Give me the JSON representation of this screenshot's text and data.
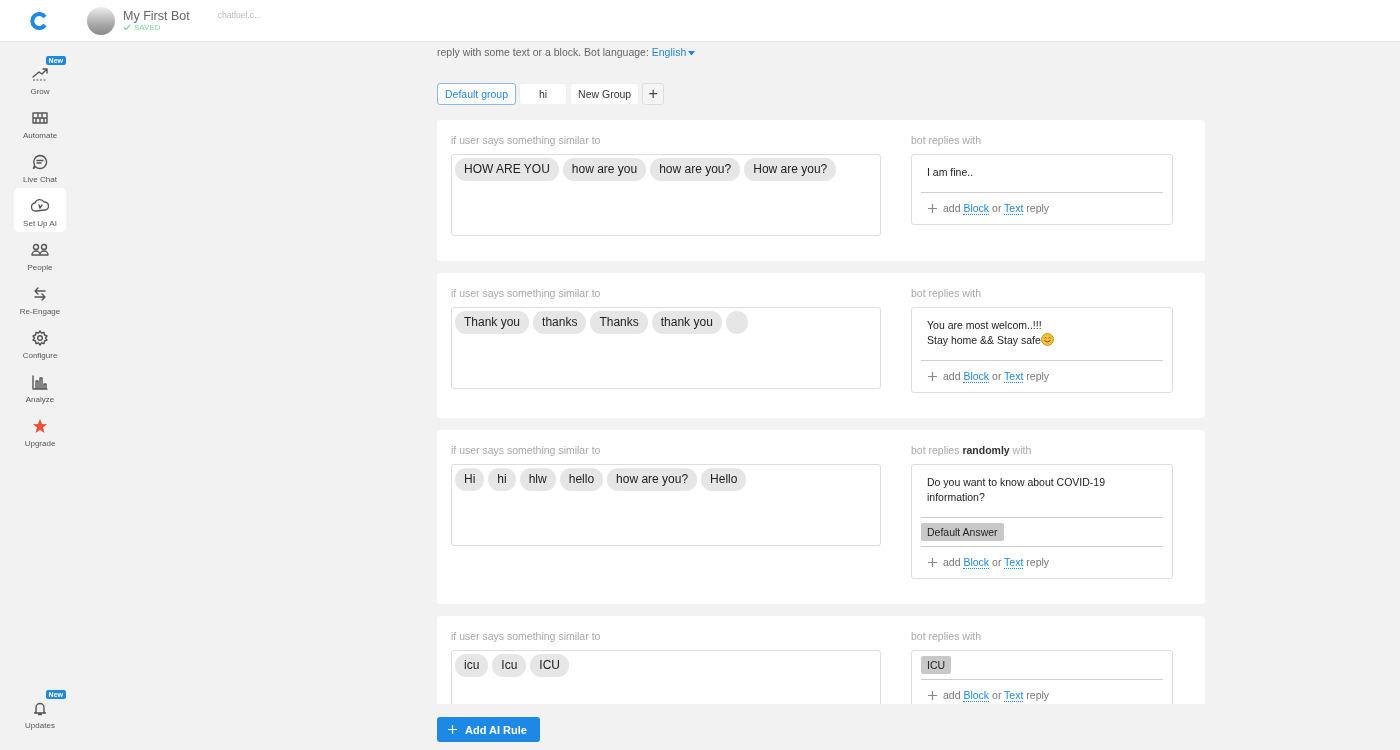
{
  "header": {
    "bot_name": "My First Bot",
    "status": "SAVED",
    "url": "chatfuel.c..."
  },
  "sidebar": {
    "items": [
      {
        "label": "Grow",
        "badge": "New",
        "selected": false
      },
      {
        "label": "Automate",
        "selected": false
      },
      {
        "label": "Live Chat",
        "selected": false
      },
      {
        "label": "Set Up AI",
        "selected": true
      },
      {
        "label": "People",
        "selected": false
      },
      {
        "label": "Re-Engage",
        "selected": false
      },
      {
        "label": "Configure",
        "selected": false
      },
      {
        "label": "Analyze",
        "selected": false
      },
      {
        "label": "Upgrade",
        "selected": false
      }
    ],
    "bottom_item": {
      "label": "Updates",
      "badge": "New"
    }
  },
  "intro": {
    "text": "reply with some text or a block. Bot language:",
    "language": "English"
  },
  "groups": [
    {
      "label": "Default group",
      "selected": true
    },
    {
      "label": "hi",
      "selected": false
    },
    {
      "label": "New Group",
      "selected": false
    }
  ],
  "add_group": "+",
  "rules": [
    {
      "user_label": "if user says something similar to",
      "phrases": [
        "HOW ARE YOU",
        "how are you",
        "how are you?",
        "How are you?"
      ],
      "input_chip": false,
      "bot_label": "bot replies with",
      "replies": [
        {
          "kind": "text",
          "text": "I am fine.."
        }
      ],
      "footer": {
        "add": "add",
        "block": "Block",
        "or": "or",
        "text": "Text",
        "reply": "reply"
      }
    },
    {
      "user_label": "if user says something similar to",
      "phrases": [
        "Thank you",
        "thanks",
        "Thanks",
        "thank you"
      ],
      "input_chip": true,
      "bot_label": "bot replies with",
      "replies": [
        {
          "kind": "emoji",
          "lines": [
            "You are most welcom..!!!",
            "Stay home && Stay safe"
          ]
        }
      ],
      "footer": {
        "add": "add",
        "block": "Block",
        "or": "or",
        "text": "Text",
        "reply": "reply"
      }
    },
    {
      "user_label": "if user says something similar to",
      "phrases": [
        "Hi",
        "hi",
        "hlw",
        "hello",
        "how are you?",
        "Hello"
      ],
      "input_chip": false,
      "bot_label": "bot replies **randomly** with",
      "replies": [
        {
          "kind": "text",
          "text": "Do you want to know about  COVID-19 information?"
        },
        {
          "kind": "block",
          "text": "Default Answer"
        }
      ],
      "footer": {
        "add": "add",
        "block": "Block",
        "or": "or",
        "text": "Text",
        "reply": "reply"
      }
    },
    {
      "user_label": "if user says something similar to",
      "phrases": [
        "icu",
        "Icu",
        "ICU"
      ],
      "input_chip": false,
      "bot_label": "bot replies with",
      "replies": [
        {
          "kind": "block",
          "text": "ICU"
        }
      ],
      "footer": {
        "add": "add",
        "block": "Block",
        "or": "or",
        "text": "Text",
        "reply": "reply"
      }
    }
  ],
  "add_rule_button": "Add AI Rule"
}
